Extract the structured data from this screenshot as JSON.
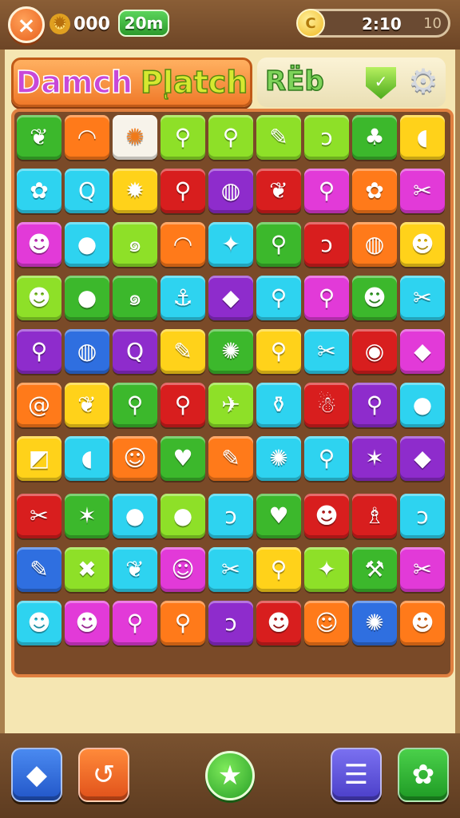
{
  "header": {
    "close_label": "×",
    "coin_icon": "gear-coin-icon",
    "coins": "000",
    "mode_label": "20m",
    "timer_coin_label": "C",
    "timer": "2:10",
    "timer_secondary": "10"
  },
  "title": {
    "word1": "Damch",
    "word2": "Plͅatch",
    "score_label": "RЁb",
    "shield_icon": "shield-icon",
    "settings_icon": "gear-icon"
  },
  "palette": {
    "g": "#3cb82c",
    "o": "#ff7a1a",
    "w": "#f7f3ea",
    "l": "#8ee028",
    "p": "#e23ad8",
    "y": "#ffd21a",
    "c": "#2ed3f0",
    "r": "#d81e1e",
    "v": "#8e2ccc",
    "b": "#2f6fe0"
  },
  "board": {
    "rows": [
      [
        {
          "c": "g",
          "i": "❦"
        },
        {
          "c": "o",
          "i": "◠"
        },
        {
          "c": "w",
          "i": "✺"
        },
        {
          "c": "l",
          "i": "⚲"
        },
        {
          "c": "l",
          "i": "⚲"
        },
        {
          "c": "l",
          "i": "✎"
        },
        {
          "c": "l",
          "i": "ↄ"
        },
        {
          "c": "g",
          "i": "♣"
        },
        {
          "c": "y",
          "i": "◖"
        }
      ],
      [
        {
          "c": "c",
          "i": "✿"
        },
        {
          "c": "c",
          "i": "Q"
        },
        {
          "c": "y",
          "i": "✹"
        },
        {
          "c": "r",
          "i": "⚲"
        },
        {
          "c": "v",
          "i": "◍"
        },
        {
          "c": "r",
          "i": "❦"
        },
        {
          "c": "p",
          "i": "⚲"
        },
        {
          "c": "o",
          "i": "✿"
        },
        {
          "c": "p",
          "i": "✂"
        }
      ],
      [
        {
          "c": "p",
          "i": "☻"
        },
        {
          "c": "c",
          "i": "●"
        },
        {
          "c": "l",
          "i": "๑"
        },
        {
          "c": "o",
          "i": "◠"
        },
        {
          "c": "c",
          "i": "✦"
        },
        {
          "c": "g",
          "i": "⚲"
        },
        {
          "c": "r",
          "i": "ↄ"
        },
        {
          "c": "o",
          "i": "◍"
        },
        {
          "c": "y",
          "i": "☻"
        }
      ],
      [
        {
          "c": "l",
          "i": "☻"
        },
        {
          "c": "g",
          "i": "●"
        },
        {
          "c": "g",
          "i": "๑"
        },
        {
          "c": "c",
          "i": "⚓"
        },
        {
          "c": "v",
          "i": "◆"
        },
        {
          "c": "c",
          "i": "⚲"
        },
        {
          "c": "p",
          "i": "⚲"
        },
        {
          "c": "g",
          "i": "☻"
        },
        {
          "c": "c",
          "i": "✂"
        }
      ],
      [
        {
          "c": "v",
          "i": "⚲"
        },
        {
          "c": "b",
          "i": "◍"
        },
        {
          "c": "v",
          "i": "Q"
        },
        {
          "c": "y",
          "i": "✎"
        },
        {
          "c": "g",
          "i": "✺"
        },
        {
          "c": "y",
          "i": "⚲"
        },
        {
          "c": "c",
          "i": "✂"
        },
        {
          "c": "r",
          "i": "◉"
        },
        {
          "c": "p",
          "i": "◆"
        }
      ],
      [
        {
          "c": "o",
          "i": "@"
        },
        {
          "c": "y",
          "i": "❦"
        },
        {
          "c": "g",
          "i": "⚲"
        },
        {
          "c": "r",
          "i": "⚲"
        },
        {
          "c": "l",
          "i": "✈"
        },
        {
          "c": "c",
          "i": "⚱"
        },
        {
          "c": "r",
          "i": "☃"
        },
        {
          "c": "v",
          "i": "⚲"
        },
        {
          "c": "c",
          "i": "●"
        }
      ],
      [
        {
          "c": "y",
          "i": "◩"
        },
        {
          "c": "c",
          "i": "◖"
        },
        {
          "c": "o",
          "i": "☺"
        },
        {
          "c": "g",
          "i": "♥"
        },
        {
          "c": "o",
          "i": "✎"
        },
        {
          "c": "c",
          "i": "✺"
        },
        {
          "c": "c",
          "i": "⚲"
        },
        {
          "c": "v",
          "i": "✶"
        },
        {
          "c": "v",
          "i": "◆"
        }
      ],
      [
        {
          "c": "r",
          "i": "✂"
        },
        {
          "c": "g",
          "i": "✶"
        },
        {
          "c": "c",
          "i": "●"
        },
        {
          "c": "l",
          "i": "●"
        },
        {
          "c": "c",
          "i": "ↄ"
        },
        {
          "c": "g",
          "i": "♥"
        },
        {
          "c": "r",
          "i": "☻"
        },
        {
          "c": "r",
          "i": "♗"
        },
        {
          "c": "c",
          "i": "ↄ"
        }
      ],
      [
        {
          "c": "b",
          "i": "✎"
        },
        {
          "c": "l",
          "i": "✖"
        },
        {
          "c": "c",
          "i": "❦"
        },
        {
          "c": "p",
          "i": "☺"
        },
        {
          "c": "c",
          "i": "✂"
        },
        {
          "c": "y",
          "i": "⚲"
        },
        {
          "c": "l",
          "i": "✦"
        },
        {
          "c": "g",
          "i": "⚒"
        },
        {
          "c": "p",
          "i": "✂"
        }
      ],
      [
        {
          "c": "c",
          "i": "☻"
        },
        {
          "c": "p",
          "i": "☻"
        },
        {
          "c": "p",
          "i": "⚲"
        },
        {
          "c": "o",
          "i": "⚲"
        },
        {
          "c": "v",
          "i": "ↄ"
        },
        {
          "c": "r",
          "i": "☻"
        },
        {
          "c": "o",
          "i": "☺"
        },
        {
          "c": "b",
          "i": "✺"
        },
        {
          "c": "o",
          "i": "☻"
        }
      ]
    ]
  },
  "bottom": {
    "eraser_icon": "◆",
    "undo_icon": "↺",
    "star_icon": "★",
    "list_icon": "☰",
    "settings_icon": "✿"
  }
}
